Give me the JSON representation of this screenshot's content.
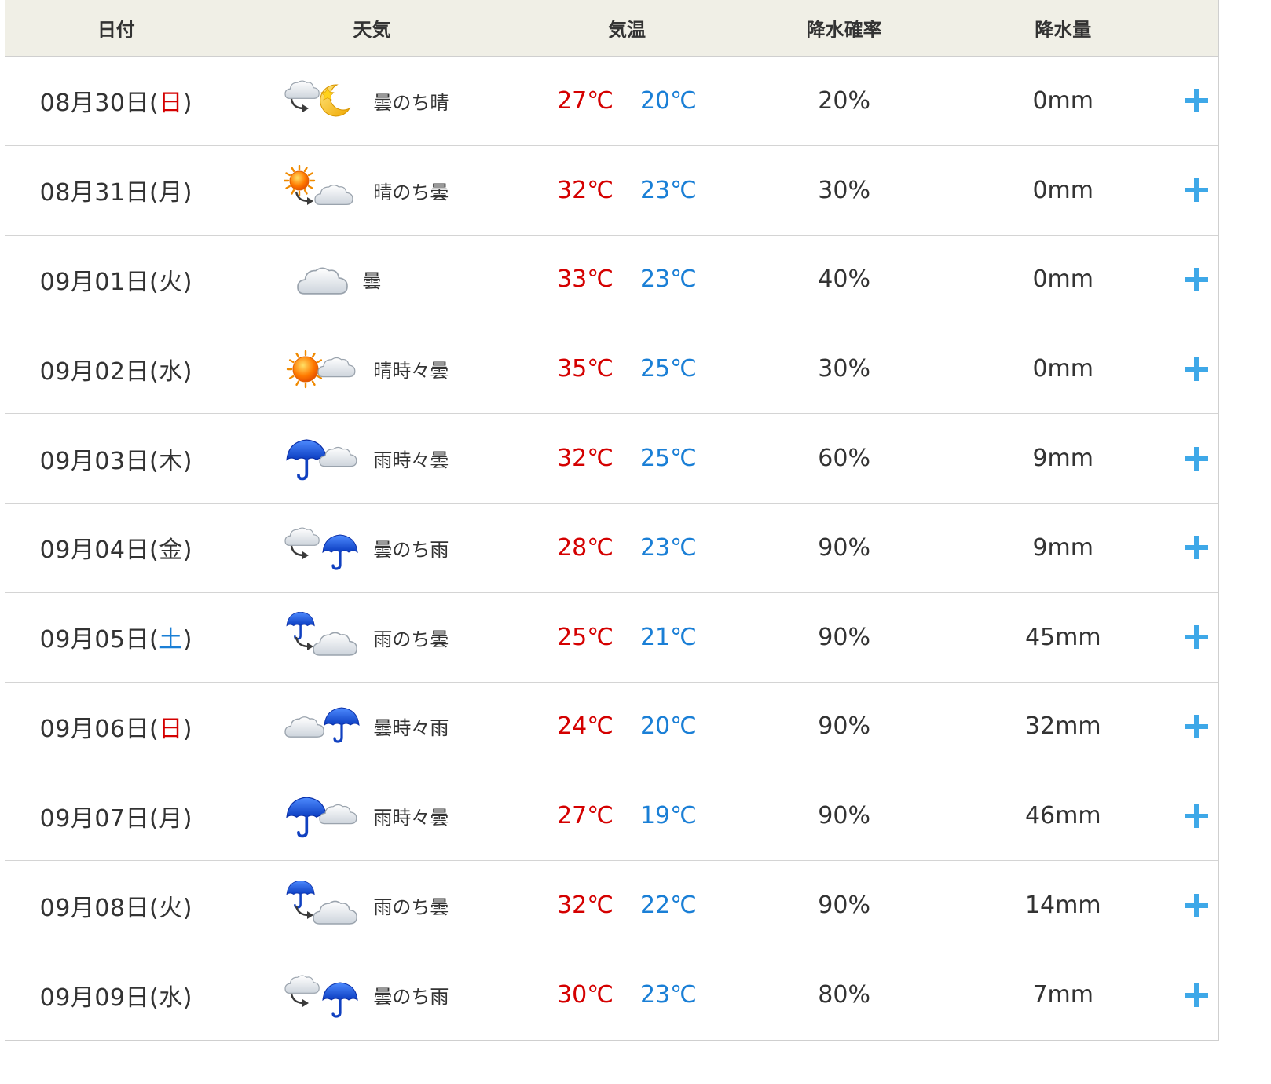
{
  "header": {
    "date": "日付",
    "weather": "天気",
    "temp": "気温",
    "prob": "降水確率",
    "amount": "降水量"
  },
  "colors": {
    "high_temp": "#d40000",
    "low_temp": "#1a7fd6",
    "sunday": "#d40000",
    "saturday": "#1a7fd6",
    "expand": "#3ea8e8",
    "header_bg": "#f0efe6"
  },
  "rows": [
    {
      "date": "08月30日(",
      "dow": "日",
      "close": ")",
      "dow_type": "sun",
      "icon": "cloudy-then-clear-night-icon",
      "weather": "曇のち晴",
      "high": "27℃",
      "low": "20℃",
      "prob": "20%",
      "amount": "0mm"
    },
    {
      "date": "08月31日(",
      "dow": "月",
      "close": ")",
      "dow_type": "weekday",
      "icon": "sunny-then-cloudy-icon",
      "weather": "晴のち曇",
      "high": "32℃",
      "low": "23℃",
      "prob": "30%",
      "amount": "0mm"
    },
    {
      "date": "09月01日(",
      "dow": "火",
      "close": ")",
      "dow_type": "weekday",
      "icon": "cloudy-icon",
      "weather": "曇",
      "high": "33℃",
      "low": "23℃",
      "prob": "40%",
      "amount": "0mm"
    },
    {
      "date": "09月02日(",
      "dow": "水",
      "close": ")",
      "dow_type": "weekday",
      "icon": "sunny-sometimes-cloudy-icon",
      "weather": "晴時々曇",
      "high": "35℃",
      "low": "25℃",
      "prob": "30%",
      "amount": "0mm"
    },
    {
      "date": "09月03日(",
      "dow": "木",
      "close": ")",
      "dow_type": "weekday",
      "icon": "rain-sometimes-cloudy-icon",
      "weather": "雨時々曇",
      "high": "32℃",
      "low": "25℃",
      "prob": "60%",
      "amount": "9mm"
    },
    {
      "date": "09月04日(",
      "dow": "金",
      "close": ")",
      "dow_type": "weekday",
      "icon": "cloudy-then-rain-icon",
      "weather": "曇のち雨",
      "high": "28℃",
      "low": "23℃",
      "prob": "90%",
      "amount": "9mm"
    },
    {
      "date": "09月05日(",
      "dow": "土",
      "close": ")",
      "dow_type": "sat",
      "icon": "rain-then-cloudy-icon",
      "weather": "雨のち曇",
      "high": "25℃",
      "low": "21℃",
      "prob": "90%",
      "amount": "45mm"
    },
    {
      "date": "09月06日(",
      "dow": "日",
      "close": ")",
      "dow_type": "sun",
      "icon": "cloudy-sometimes-rain-icon",
      "weather": "曇時々雨",
      "high": "24℃",
      "low": "20℃",
      "prob": "90%",
      "amount": "32mm"
    },
    {
      "date": "09月07日(",
      "dow": "月",
      "close": ")",
      "dow_type": "weekday",
      "icon": "rain-sometimes-cloudy-icon",
      "weather": "雨時々曇",
      "high": "27℃",
      "low": "19℃",
      "prob": "90%",
      "amount": "46mm"
    },
    {
      "date": "09月08日(",
      "dow": "火",
      "close": ")",
      "dow_type": "weekday",
      "icon": "rain-then-cloudy-icon",
      "weather": "雨のち曇",
      "high": "32℃",
      "low": "22℃",
      "prob": "90%",
      "amount": "14mm"
    },
    {
      "date": "09月09日(",
      "dow": "水",
      "close": ")",
      "dow_type": "weekday",
      "icon": "cloudy-then-rain-icon",
      "weather": "曇のち雨",
      "high": "30℃",
      "low": "23℃",
      "prob": "80%",
      "amount": "7mm"
    }
  ]
}
